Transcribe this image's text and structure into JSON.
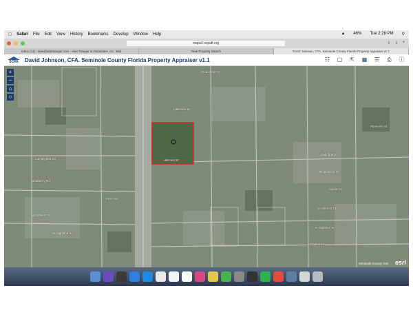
{
  "menubar": {
    "items": [
      "Safari",
      "File",
      "Edit",
      "View",
      "History",
      "Bookmarks",
      "Develop",
      "Window",
      "Help"
    ],
    "battery": "46%",
    "clock": "Tue 2:26 PM"
  },
  "browser": {
    "url": "maps2.scpafl.org",
    "tabs": [
      "Inbox (11) - alan@alantrauger.com - Alan Trauger & Associates, Inc. Mail",
      "Real Property Search",
      "David Johnson, CFA.   Seminole County Florida Property Appraiser v1.1"
    ]
  },
  "app": {
    "logo_text": "SCPA",
    "title": "David Johnson, CFA.   Seminole County Florida Property Appraiser v1.1"
  },
  "map": {
    "streets": [
      "Lakeview Dr",
      "Clearwater Ct",
      "Lamplighter Cir",
      "Bradberry Rd",
      "Woodland Ct",
      "W Highland St",
      "Pine Ave",
      "Hillcrest St",
      "Oakridge St",
      "Ridgewood St",
      "Alpine St",
      "E Hillcrest Ct",
      "E Highland St",
      "Pinecrest St",
      "Clayton Ct"
    ],
    "attribution": "Seminole County GIS",
    "brand": "esri"
  },
  "colors": {
    "accent": "#1d3b6b",
    "parcel_outline": "#d42a2a"
  }
}
